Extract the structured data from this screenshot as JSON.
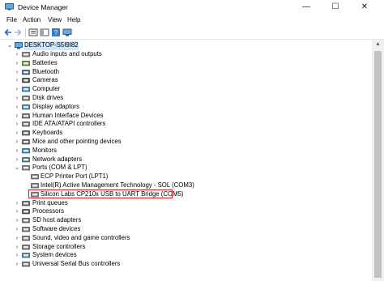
{
  "window": {
    "title": "Device Manager",
    "controls": {
      "minimize": "—",
      "maximize": "☐",
      "close": "✕"
    }
  },
  "menu": [
    "File",
    "Action",
    "View",
    "Help"
  ],
  "toolbar": [
    {
      "name": "back-button",
      "icon": "arrow-left-icon"
    },
    {
      "name": "forward-button",
      "icon": "arrow-right-icon"
    },
    {
      "name": "properties-button",
      "icon": "properties-icon"
    },
    {
      "name": "toggle-view-button",
      "icon": "console-tree-icon"
    },
    {
      "name": "help-button",
      "icon": "help-icon"
    },
    {
      "name": "scan-hardware-button",
      "icon": "monitor-icon"
    }
  ],
  "tree": {
    "root": "DESKTOP-S5I9I82",
    "items": [
      {
        "label": "Audio inputs and outputs",
        "icon": "speaker-icon",
        "level": 1,
        "expanded": false
      },
      {
        "label": "Batteries",
        "icon": "battery-icon",
        "level": 1,
        "expanded": false
      },
      {
        "label": "Bluetooth",
        "icon": "bluetooth-icon",
        "level": 1,
        "expanded": false
      },
      {
        "label": "Cameras",
        "icon": "camera-icon",
        "level": 1,
        "expanded": false
      },
      {
        "label": "Computer",
        "icon": "computer-icon",
        "level": 1,
        "expanded": false
      },
      {
        "label": "Disk drives",
        "icon": "disk-icon",
        "level": 1,
        "expanded": false
      },
      {
        "label": "Display adaptors",
        "icon": "display-icon",
        "level": 1,
        "expanded": false
      },
      {
        "label": "Human Interface Devices",
        "icon": "hid-icon",
        "level": 1,
        "expanded": false
      },
      {
        "label": "IDE ATA/ATAPI controllers",
        "icon": "ide-icon",
        "level": 1,
        "expanded": false
      },
      {
        "label": "Keyboards",
        "icon": "keyboard-icon",
        "level": 1,
        "expanded": false
      },
      {
        "label": "Mice and other pointing devices",
        "icon": "mouse-icon",
        "level": 1,
        "expanded": false
      },
      {
        "label": "Monitors",
        "icon": "monitor-icon",
        "level": 1,
        "expanded": false
      },
      {
        "label": "Network adapters",
        "icon": "network-icon",
        "level": 1,
        "expanded": false
      },
      {
        "label": "Ports (COM & LPT)",
        "icon": "port-icon",
        "level": 1,
        "expanded": true
      },
      {
        "label": "ECP Printer Port (LPT1)",
        "icon": "port-icon",
        "level": 2
      },
      {
        "label": "Intel(R) Active Management Technology - SOL (COM3)",
        "icon": "port-icon",
        "level": 2
      },
      {
        "label": "Silicon Labs CP210x USB to UART Bridge (COM5)",
        "icon": "port-icon",
        "level": 2,
        "highlighted": true
      },
      {
        "label": "Print queues",
        "icon": "printer-icon",
        "level": 1,
        "expanded": false
      },
      {
        "label": "Processors",
        "icon": "processor-icon",
        "level": 1,
        "expanded": false
      },
      {
        "label": "SD host adapters",
        "icon": "sd-card-icon",
        "level": 1,
        "expanded": false
      },
      {
        "label": "Software devices",
        "icon": "software-device-icon",
        "level": 1,
        "expanded": false
      },
      {
        "label": "Sound, video and game controllers",
        "icon": "sound-icon",
        "level": 1,
        "expanded": false
      },
      {
        "label": "Storage controllers",
        "icon": "storage-icon",
        "level": 1,
        "expanded": false
      },
      {
        "label": "System devices",
        "icon": "system-icon",
        "level": 1,
        "expanded": false
      },
      {
        "label": "Universal Serial Bus controllers",
        "icon": "usb-icon",
        "level": 1,
        "expanded": false
      }
    ]
  },
  "colors": {
    "highlight_border": "#d7181e",
    "icon_blue": "#2b6cb0",
    "icon_teal": "#3a8fa8"
  }
}
